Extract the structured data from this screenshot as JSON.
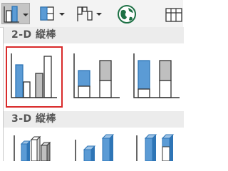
{
  "ribbon": {
    "buttons": [
      {
        "name": "column-chart-button",
        "icon": "column-chart-icon",
        "state": "active"
      },
      {
        "name": "hierarchy-chart-button",
        "icon": "treemap-icon"
      },
      {
        "name": "waterfall-chart-button",
        "icon": "waterfall-icon"
      },
      {
        "name": "map-chart-button",
        "icon": "globe-icon"
      },
      {
        "name": "pivot-chart-button",
        "icon": "pivot-chart-icon"
      }
    ]
  },
  "gallery": {
    "section_2d": {
      "heading": "2-D 縦棒"
    },
    "section_3d": {
      "heading": "3-D 縦棒"
    },
    "selected": "clustered-column"
  },
  "colors": {
    "accent_blue": "#5b9bd5",
    "accent_blue_stroke": "#2e75b6",
    "gray_bar": "#bfbfbf",
    "selection": "#d92a2a"
  }
}
